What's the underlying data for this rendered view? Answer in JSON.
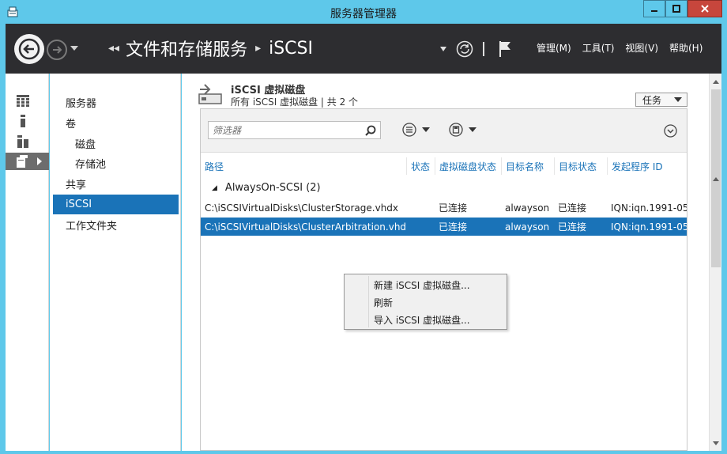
{
  "window": {
    "title": "服务器管理器",
    "colors": {
      "frame": "#5ec8ea",
      "header": "#2d2d30",
      "accent": "#1a73b8",
      "close": "#c7463c"
    }
  },
  "header": {
    "breadcrumb": [
      "文件和存储服务",
      "iSCSI"
    ],
    "menus": [
      "管理(M)",
      "工具(T)",
      "视图(V)",
      "帮助(H)"
    ],
    "icons": [
      "back-arrow-icon",
      "forward-arrow-icon",
      "refresh-icon",
      "flag-icon"
    ]
  },
  "rail": {
    "icons": [
      "dashboard-icon",
      "local-server-icon",
      "all-servers-icon",
      "file-storage-icon"
    ]
  },
  "nav": {
    "items": [
      {
        "label": "服务器"
      },
      {
        "label": "卷"
      },
      {
        "label": "磁盘"
      },
      {
        "label": "存储池"
      },
      {
        "label": "共享"
      },
      {
        "label": "iSCSI"
      },
      {
        "label": "工作文件夹"
      }
    ]
  },
  "section": {
    "title": "iSCSI 虚拟磁盘",
    "subtitle": "所有 iSCSI 虚拟磁盘 | 共 2 个",
    "tasks_label": "任务"
  },
  "toolbar": {
    "filter_placeholder": "筛选器"
  },
  "table": {
    "columns": [
      "路径",
      "状态",
      "虚拟磁盘状态",
      "目标名称",
      "目标状态",
      "发起程序 ID"
    ],
    "group": "AlwaysOn-SCSI (2)",
    "rows": [
      {
        "path": "C:\\iSCSIVirtualDisks\\ClusterStorage.vhdx",
        "status": "",
        "disk_status": "已连接",
        "target": "alwayson",
        "target_status": "已连接",
        "initiator": "IQN:iqn.1991-05"
      },
      {
        "path": "C:\\iSCSIVirtualDisks\\ClusterArbitration.vhdx",
        "status": "",
        "disk_status": "已连接",
        "target": "alwayson",
        "target_status": "已连接",
        "initiator": "IQN:iqn.1991-05"
      }
    ]
  },
  "context_menu": {
    "items": [
      "新建 iSCSI 虚拟磁盘...",
      "刷新",
      "导入 iSCSI 虚拟磁盘..."
    ]
  }
}
